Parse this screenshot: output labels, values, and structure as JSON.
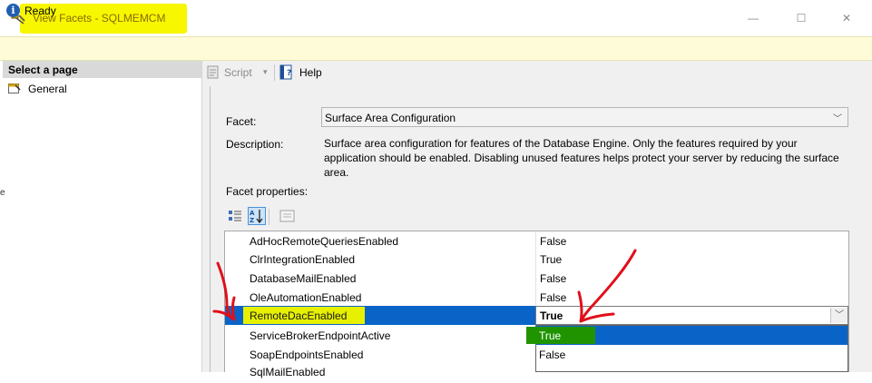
{
  "window": {
    "title": "View Facets - SQLMEMCM",
    "controls": {
      "minimize": "—",
      "maximize": "☐",
      "close": "✕"
    }
  },
  "status": {
    "text": "Ready",
    "icon": "info-icon"
  },
  "left_pane": {
    "header": "Select a page",
    "items": [
      {
        "label": "General",
        "icon": "general-page-icon"
      }
    ]
  },
  "toolbar": {
    "script_label": "Script",
    "help_label": "Help"
  },
  "form": {
    "facet_label": "Facet:",
    "facet_value": "Surface Area Configuration",
    "description_label": "Description:",
    "description_text": "Surface area configuration for features of the Database Engine. Only the features required by your application should be enabled. Disabling unused features helps protect your server by reducing the surface area.",
    "facet_properties_label": "Facet properties:"
  },
  "properties": [
    {
      "name": "AdHocRemoteQueriesEnabled",
      "value": "False"
    },
    {
      "name": "ClrIntegrationEnabled",
      "value": "True"
    },
    {
      "name": "DatabaseMailEnabled",
      "value": "False"
    },
    {
      "name": "OleAutomationEnabled",
      "value": "False"
    },
    {
      "name": "RemoteDacEnabled",
      "value": "True",
      "selected": true
    },
    {
      "name": "ServiceBrokerEndpointActive",
      "value": ""
    },
    {
      "name": "SoapEndpointsEnabled",
      "value": ""
    },
    {
      "name": "SqlMailEnabled",
      "value": ""
    }
  ],
  "dropdown_options": [
    "True",
    "False"
  ],
  "colors": {
    "title_highlight": "#f7f700",
    "selection_blue": "#0a64c8",
    "name_highlight": "#e6f000",
    "option_highlight": "#1f9400",
    "annotation_red": "#e0101a"
  }
}
